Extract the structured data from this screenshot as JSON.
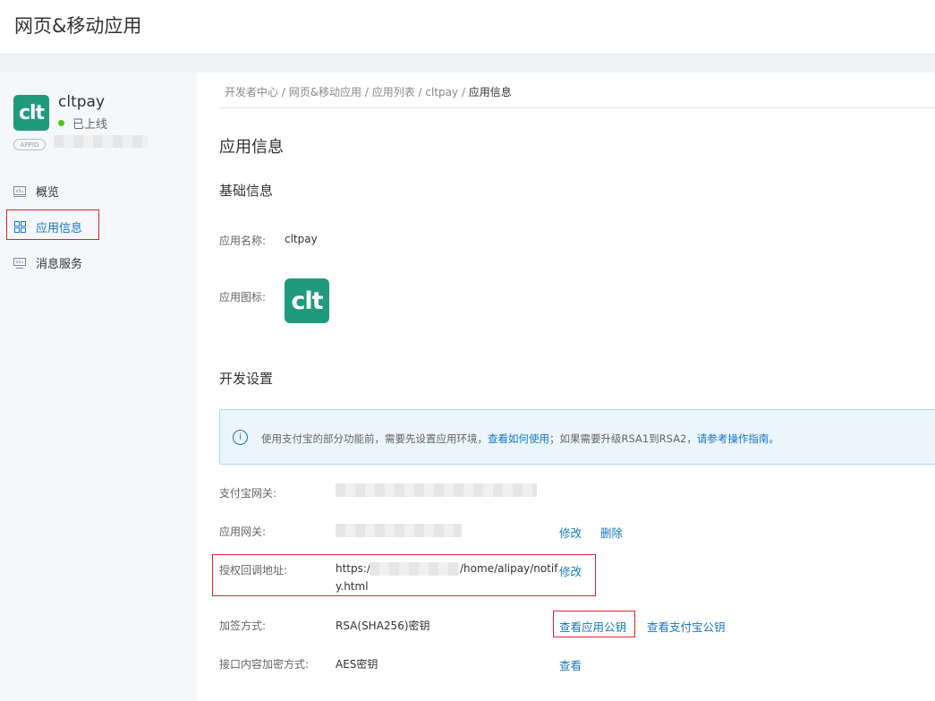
{
  "header": {
    "title": "网页&移动应用"
  },
  "app": {
    "logo_text": "clt",
    "name": "cltpay",
    "status": "已上线",
    "appid_badge": "APPID"
  },
  "nav": [
    {
      "label": "概览",
      "icon": "chart-icon"
    },
    {
      "label": "应用信息",
      "icon": "grid-icon",
      "active": true
    },
    {
      "label": "消息服务",
      "icon": "monitor-icon"
    }
  ],
  "breadcrumb": {
    "items": [
      "开发者中心",
      "网页&移动应用",
      "应用列表",
      "cltpay"
    ],
    "separator": " / ",
    "current": "应用信息"
  },
  "page": {
    "title": "应用信息"
  },
  "basic": {
    "title": "基础信息",
    "name_label": "应用名称:",
    "name_value": "cltpay",
    "icon_label": "应用图标:",
    "icon_text": "clt"
  },
  "dev": {
    "title": "开发设置",
    "notice": {
      "text1": "使用支付宝的部分功能前，需要先设置应用环境，",
      "link1": "查看如何使用",
      "text2": "；如果需要升级RSA1到RSA2，",
      "link2": "请参考操作指南。"
    },
    "gateway_label": "支付宝网关:",
    "app_gateway_label": "应用网关:",
    "app_gateway_edit": "修改",
    "app_gateway_delete": "删除",
    "callback_label": "授权回调地址:",
    "callback_prefix": "https:/",
    "callback_suffix": "/home/alipay/notif",
    "callback_wrap": "y.html",
    "callback_edit": "修改",
    "sign_label": "加签方式:",
    "sign_value": "RSA(SHA256)密钥",
    "view_app_key": "查看应用公钥",
    "view_alipay_key": "查看支付宝公钥",
    "encrypt_label": "接口内容加密方式:",
    "encrypt_value": "AES密钥",
    "encrypt_view": "查看"
  },
  "colors": {
    "brand": "#1f9a7d",
    "link": "#1677c6",
    "highlight": "#e0242a",
    "online": "#52c41a"
  }
}
